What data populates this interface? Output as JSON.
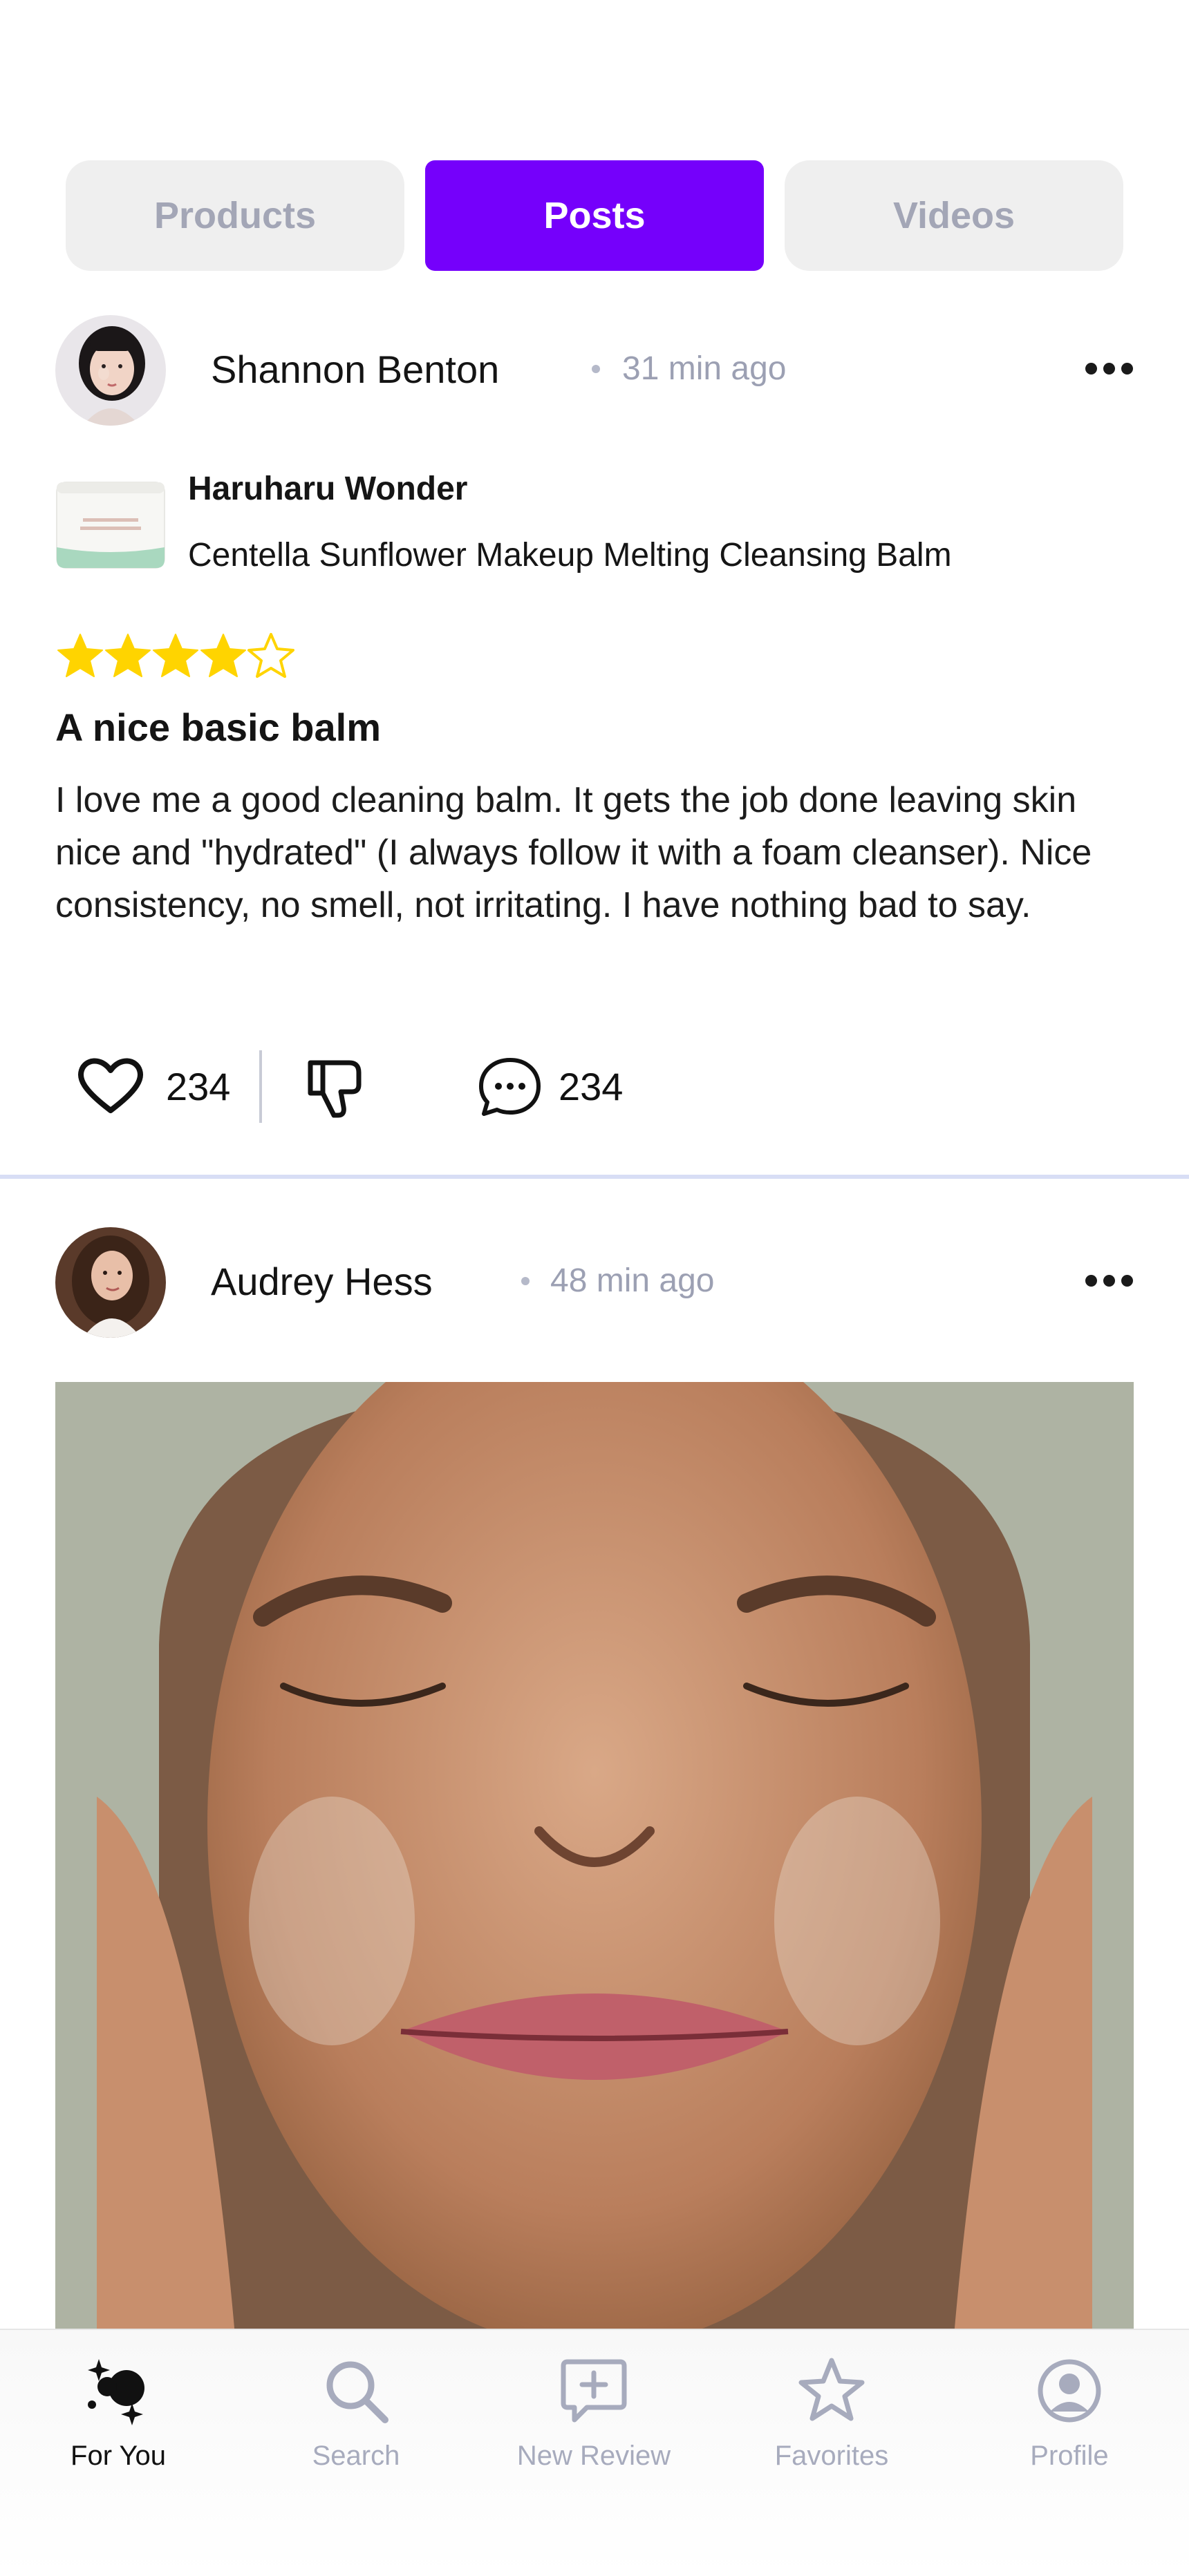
{
  "tabs": [
    {
      "label": "Products",
      "active": false
    },
    {
      "label": "Posts",
      "active": true
    },
    {
      "label": "Videos",
      "active": false
    }
  ],
  "colors": {
    "accent": "#7500fb",
    "star": "#ffd400",
    "muted": "#a3a6b6"
  },
  "posts": [
    {
      "author": "Shannon Benton",
      "time": "31 min ago",
      "product": {
        "brand": "Haruharu Wonder",
        "name": "Centella Sunflower Makeup Melting Cleansing Balm"
      },
      "rating": 4,
      "rating_max": 5,
      "title": "A nice basic balm",
      "body": "I love me a good cleaning balm. It gets the job done leaving skin nice and \"hydrated\" (I always follow it with a foam cleanser). Nice consistency, no smell, not irritating. I have nothing bad to say.",
      "likes": "234",
      "comments": "234"
    },
    {
      "author": "Audrey Hess",
      "time": "48 min ago"
    }
  ],
  "bottom_nav": [
    {
      "label": "For You",
      "icon": "sparkles-icon",
      "active": true
    },
    {
      "label": "Search",
      "icon": "search-icon",
      "active": false
    },
    {
      "label": "New Review",
      "icon": "add-review-icon",
      "active": false
    },
    {
      "label": "Favorites",
      "icon": "star-icon",
      "active": false
    },
    {
      "label": "Profile",
      "icon": "profile-icon",
      "active": false
    }
  ]
}
